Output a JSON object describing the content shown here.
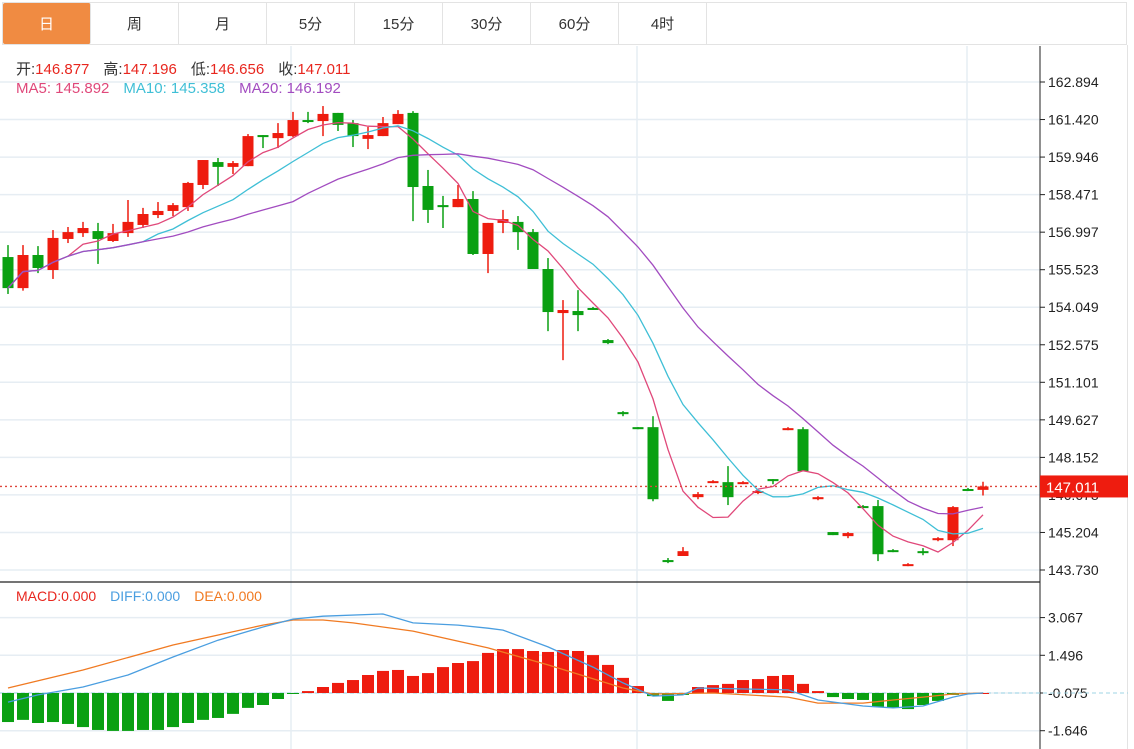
{
  "tabs": [
    "日",
    "周",
    "月",
    "5分",
    "15分",
    "30分",
    "60分",
    "4时"
  ],
  "active_tab": 0,
  "ohlc_legend": {
    "open_label": "开:",
    "open": "146.877",
    "high_label": "高:",
    "high": "147.196",
    "low_label": "低:",
    "low": "146.656",
    "close_label": "收:",
    "close": "147.011"
  },
  "ma_legend": {
    "ma5": "MA5: 145.892",
    "ma10": "MA10: 145.358",
    "ma20": "MA20: 146.192"
  },
  "macd_legend": {
    "macd_label": "MACD:",
    "macd": "0.000",
    "diff_label": "DIFF:",
    "diff": "0.000",
    "dea_label": "DEA:",
    "dea": "0.000"
  },
  "colors": {
    "up": "#ee1c0f",
    "down": "#0aa012",
    "ma5": "#e0487a",
    "ma10": "#3fbfd6",
    "ma20": "#a24cc0",
    "diff": "#4a9ee0",
    "dea": "#f07a22",
    "accent": "#f08b42"
  },
  "chart_data": [
    {
      "type": "candlestick",
      "title": "",
      "y_ticks": [
        "162.894",
        "161.420",
        "159.946",
        "158.471",
        "156.997",
        "155.523",
        "154.049",
        "152.575",
        "151.101",
        "149.627",
        "148.152",
        "146.678",
        "145.204",
        "143.730"
      ],
      "ylim": [
        143.73,
        162.894
      ],
      "last_price": "147.011",
      "candles": [
        [
          156.02,
          156.49,
          154.57,
          154.8
        ],
        [
          154.8,
          156.49,
          154.7,
          156.1
        ],
        [
          156.1,
          156.45,
          155.39,
          155.59
        ],
        [
          155.51,
          157.08,
          155.16,
          156.77
        ],
        [
          156.73,
          157.2,
          156.57,
          157.0
        ],
        [
          156.96,
          157.4,
          156.81,
          157.16
        ],
        [
          157.04,
          157.36,
          155.75,
          156.73
        ],
        [
          156.65,
          157.32,
          156.61,
          156.96
        ],
        [
          156.96,
          158.26,
          156.81,
          157.4
        ],
        [
          157.28,
          157.95,
          157.16,
          157.71
        ],
        [
          157.67,
          158.18,
          157.55,
          157.83
        ],
        [
          157.83,
          158.14,
          157.63,
          158.06
        ],
        [
          157.98,
          158.97,
          157.83,
          158.93
        ],
        [
          158.85,
          159.83,
          158.69,
          159.83
        ],
        [
          159.75,
          159.91,
          158.81,
          159.56
        ],
        [
          159.56,
          159.79,
          159.28,
          159.71
        ],
        [
          159.59,
          160.85,
          159.59,
          160.77
        ],
        [
          160.81,
          160.81,
          160.3,
          160.73
        ],
        [
          160.69,
          161.28,
          160.3,
          160.89
        ],
        [
          160.77,
          161.72,
          160.73,
          161.4
        ],
        [
          161.4,
          161.72,
          161.28,
          161.36
        ],
        [
          161.36,
          161.95,
          160.77,
          161.64
        ],
        [
          161.68,
          161.68,
          160.97,
          161.21
        ],
        [
          161.28,
          161.4,
          160.34,
          160.77
        ],
        [
          160.66,
          161.13,
          160.26,
          160.81
        ],
        [
          160.77,
          161.52,
          160.77,
          161.28
        ],
        [
          161.24,
          161.79,
          161.24,
          161.64
        ],
        [
          161.68,
          161.75,
          157.43,
          158.77
        ],
        [
          158.81,
          159.44,
          157.36,
          157.87
        ],
        [
          158.06,
          158.42,
          157.16,
          157.98
        ],
        [
          157.98,
          158.85,
          157.98,
          158.3
        ],
        [
          158.3,
          158.61,
          156.1,
          156.14
        ],
        [
          156.14,
          157.36,
          155.39,
          157.36
        ],
        [
          157.36,
          157.87,
          156.96,
          157.51
        ],
        [
          157.4,
          157.63,
          156.3,
          157.0
        ],
        [
          157.0,
          157.12,
          155.55,
          155.55
        ],
        [
          155.55,
          155.98,
          153.11,
          153.86
        ],
        [
          153.82,
          154.33,
          151.97,
          153.94
        ],
        [
          153.9,
          154.72,
          153.11,
          153.74
        ],
        [
          154.02,
          154.06,
          153.94,
          153.98
        ],
        [
          152.76,
          152.8,
          152.6,
          152.64
        ],
        [
          149.93,
          149.97,
          149.77,
          149.85
        ],
        [
          149.34,
          149.34,
          149.26,
          149.26
        ],
        [
          149.34,
          149.77,
          146.43,
          146.51
        ],
        [
          144.12,
          144.2,
          144.0,
          144.04
        ],
        [
          144.28,
          144.63,
          144.28,
          144.47
        ],
        [
          146.59,
          146.79,
          146.51,
          146.71
        ],
        [
          147.18,
          147.26,
          147.14,
          147.22
        ],
        [
          147.18,
          147.81,
          146.28,
          146.59
        ],
        [
          147.14,
          147.22,
          147.1,
          147.18
        ],
        [
          146.79,
          146.87,
          146.71,
          146.83
        ],
        [
          147.3,
          147.3,
          147.1,
          147.22
        ],
        [
          149.26,
          149.34,
          149.22,
          149.3
        ],
        [
          149.26,
          149.34,
          147.61,
          147.61
        ],
        [
          146.51,
          146.63,
          146.47,
          146.59
        ],
        [
          145.22,
          145.22,
          145.1,
          145.1
        ],
        [
          145.06,
          145.22,
          144.98,
          145.18
        ],
        [
          146.24,
          146.28,
          146.16,
          146.2
        ],
        [
          146.24,
          146.48,
          144.08,
          144.35
        ],
        [
          144.51,
          144.55,
          144.43,
          144.47
        ],
        [
          143.92,
          144.0,
          143.88,
          143.96
        ],
        [
          144.47,
          144.59,
          144.31,
          144.43
        ],
        [
          144.9,
          145.02,
          144.86,
          144.98
        ],
        [
          144.9,
          146.24,
          144.67,
          146.2
        ],
        [
          146.91,
          146.95,
          146.83,
          146.87
        ],
        [
          146.877,
          147.196,
          146.656,
          147.011
        ]
      ],
      "candle_fields": [
        "open",
        "high",
        "low",
        "close"
      ],
      "ma_periods": [
        5,
        10,
        20
      ]
    },
    {
      "type": "bar+line",
      "title": "MACD",
      "y_ticks": [
        "3.067",
        "1.496",
        "-0.075",
        "-1.646"
      ],
      "ylim": [
        -1.9,
        3.9
      ],
      "histogram": [
        -1.21,
        -1.12,
        -1.25,
        -1.21,
        -1.29,
        -1.42,
        -1.54,
        -1.58,
        -1.58,
        -1.54,
        -1.54,
        -1.42,
        -1.25,
        -1.12,
        -1.04,
        -0.87,
        -0.62,
        -0.5,
        -0.25,
        -0.04,
        0.08,
        0.25,
        0.42,
        0.54,
        0.75,
        0.92,
        0.96,
        0.71,
        0.83,
        1.08,
        1.25,
        1.33,
        1.67,
        1.83,
        1.83,
        1.75,
        1.71,
        1.79,
        1.75,
        1.58,
        1.17,
        0.63,
        0.29,
        -0.13,
        -0.33,
        -0.08,
        0.25,
        0.33,
        0.38,
        0.54,
        0.58,
        0.71,
        0.75,
        0.38,
        0.08,
        -0.17,
        -0.25,
        -0.29,
        -0.58,
        -0.62,
        -0.67,
        -0.5,
        -0.33,
        -0.08,
        -0.02,
        0
      ],
      "diff_points": [
        [
          0,
          -0.38
        ],
        [
          2,
          -0.08
        ],
        [
          5,
          0.25
        ],
        [
          8,
          0.75
        ],
        [
          11,
          1.5
        ],
        [
          14,
          2.2
        ],
        [
          17,
          2.75
        ],
        [
          19,
          3.08
        ],
        [
          21,
          3.2
        ],
        [
          25,
          3.29
        ],
        [
          27,
          2.92
        ],
        [
          30,
          2.83
        ],
        [
          32,
          2.7
        ],
        [
          33,
          2.62
        ],
        [
          36,
          1.92
        ],
        [
          39,
          1.08
        ],
        [
          41,
          0.42
        ],
        [
          43,
          -0.13
        ],
        [
          45,
          -0.08
        ],
        [
          46,
          0.21
        ],
        [
          52,
          0.13
        ],
        [
          54,
          -0.29
        ],
        [
          57,
          -0.54
        ],
        [
          59,
          -0.62
        ],
        [
          61,
          -0.54
        ],
        [
          63,
          -0.17
        ],
        [
          64,
          -0.04
        ],
        [
          65,
          0
        ]
      ],
      "dea_points": [
        [
          0,
          0.21
        ],
        [
          5,
          0.96
        ],
        [
          11,
          2.0
        ],
        [
          17,
          2.83
        ],
        [
          19,
          3.04
        ],
        [
          21,
          3.04
        ],
        [
          23,
          2.92
        ],
        [
          27,
          2.58
        ],
        [
          32,
          1.88
        ],
        [
          36,
          1.17
        ],
        [
          41,
          0.21
        ],
        [
          43,
          -0.04
        ],
        [
          47,
          0
        ],
        [
          52,
          -0.17
        ],
        [
          54,
          -0.42
        ],
        [
          57,
          -0.42
        ],
        [
          59,
          -0.29
        ],
        [
          61,
          -0.17
        ],
        [
          63,
          -0.04
        ],
        [
          65,
          0
        ]
      ]
    }
  ]
}
